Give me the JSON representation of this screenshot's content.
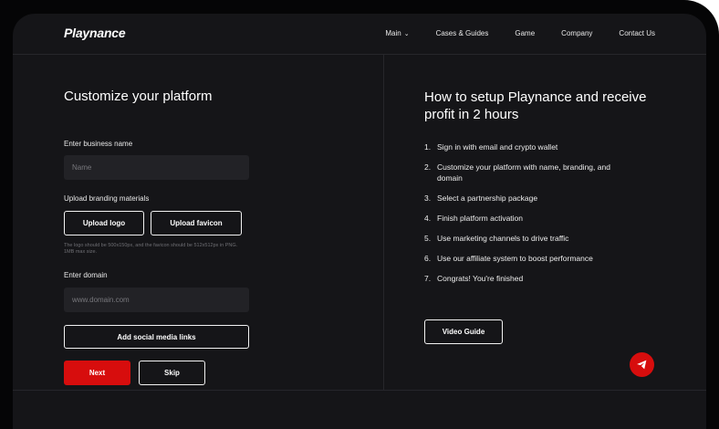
{
  "header": {
    "logo": "Playnance",
    "nav": [
      "Main",
      "Cases & Guides",
      "Game",
      "Company",
      "Contact Us"
    ]
  },
  "left": {
    "title": "Customize your platform",
    "business_label": "Enter business name",
    "business_placeholder": "Name",
    "branding_label": "Upload branding materials",
    "upload_logo": "Upload logo",
    "upload_favicon": "Upload favicon",
    "hint": "The logo should be 500x150px, and the favicon should be 512x512px in PNG. 1MB max size.",
    "domain_label": "Enter domain",
    "domain_placeholder": "www.domain.com",
    "social_button": "Add social media links",
    "next_button": "Next",
    "skip_button": "Skip"
  },
  "right": {
    "title": "How to setup Playnance and receive profit in 2 hours",
    "steps": [
      "Sign in with email and crypto wallet",
      "Customize your platform with name, branding, and domain",
      "Select a partnership package",
      "Finish platform activation",
      "Use marketing channels to drive traffic",
      "Use our affiliate system to boost performance",
      "Congrats! You're finished"
    ],
    "video_button": "Video Guide"
  },
  "colors": {
    "accent": "#d70d0d",
    "background": "#151518"
  },
  "icons": {
    "telegram": "telegram-icon",
    "chevron": "chevron-down-icon"
  }
}
